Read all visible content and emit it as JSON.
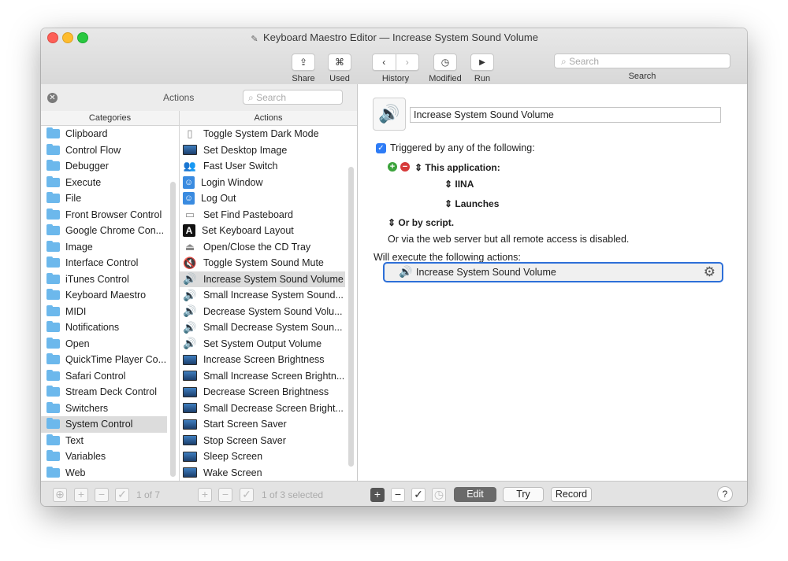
{
  "window": {
    "title": "Keyboard Maestro Editor — Increase System Sound Volume"
  },
  "toolbar": {
    "share": "Share",
    "used": "Used",
    "history": "History",
    "modified": "Modified",
    "run": "Run",
    "search_placeholder": "Search",
    "search_label": "Search"
  },
  "left_panel": {
    "title": "Actions",
    "search_placeholder": "Search",
    "categories_header": "Categories",
    "actions_header": "Actions",
    "categories": [
      "Clipboard",
      "Control Flow",
      "Debugger",
      "Execute",
      "File",
      "Front Browser Control",
      "Google Chrome Con...",
      "Image",
      "Interface Control",
      "iTunes Control",
      "Keyboard Maestro",
      "MIDI",
      "Notifications",
      "Open",
      "QuickTime Player Co...",
      "Safari Control",
      "Stream Deck Control",
      "Switchers",
      "System Control",
      "Text",
      "Variables",
      "Web"
    ],
    "selected_category": "System Control",
    "actions": [
      {
        "label": "Toggle System Dark Mode",
        "icon": "document-icon"
      },
      {
        "label": "Set Desktop Image",
        "icon": "monitor-icon"
      },
      {
        "label": "Fast User Switch",
        "icon": "users-icon"
      },
      {
        "label": "Login Window",
        "icon": "finder-icon"
      },
      {
        "label": "Log Out",
        "icon": "finder-icon"
      },
      {
        "label": "Set Find Pasteboard",
        "icon": "pasteboard-icon"
      },
      {
        "label": "Set Keyboard Layout",
        "icon": "keyboard-layout-icon"
      },
      {
        "label": "Open/Close the CD Tray",
        "icon": "eject-icon"
      },
      {
        "label": "Toggle System Sound Mute",
        "icon": "speaker-mute-icon"
      },
      {
        "label": "Increase System Sound Volume",
        "icon": "speaker-icon"
      },
      {
        "label": "Small Increase System Sound...",
        "icon": "speaker-icon"
      },
      {
        "label": "Decrease System Sound Volu...",
        "icon": "speaker-icon"
      },
      {
        "label": "Small Decrease System Soun...",
        "icon": "speaker-icon"
      },
      {
        "label": "Set System Output Volume",
        "icon": "speaker-icon"
      },
      {
        "label": "Increase Screen Brightness",
        "icon": "monitor-icon"
      },
      {
        "label": "Small Increase Screen Brightn...",
        "icon": "monitor-icon"
      },
      {
        "label": "Decrease Screen Brightness",
        "icon": "monitor-icon"
      },
      {
        "label": "Small Decrease Screen Bright...",
        "icon": "monitor-icon"
      },
      {
        "label": "Start Screen Saver",
        "icon": "monitor-icon"
      },
      {
        "label": "Stop Screen Saver",
        "icon": "monitor-icon"
      },
      {
        "label": "Sleep Screen",
        "icon": "monitor-icon"
      },
      {
        "label": "Wake Screen",
        "icon": "monitor-icon"
      }
    ],
    "selected_action": "Increase System Sound Volume"
  },
  "bottom_bar": {
    "left_count": "1 of 7",
    "middle_count": "1 of 3 selected",
    "edit": "Edit",
    "try": "Try",
    "record": "Record",
    "help": "?"
  },
  "editor": {
    "macro_name": "Increase System Sound Volume",
    "triggered_label": "Triggered by any of the following:",
    "this_application": "This application:",
    "app_name": "IINA",
    "app_event": "Launches",
    "or_by_script": "Or by script.",
    "web_server_note": "Or via the web server but all remote access is disabled.",
    "will_execute": "Will execute the following actions:",
    "action_name": "Increase System Sound Volume"
  },
  "colors": {
    "accent": "#2d6fd8",
    "folder": "#6cb8ec",
    "speaker": "#5a6fe0"
  }
}
